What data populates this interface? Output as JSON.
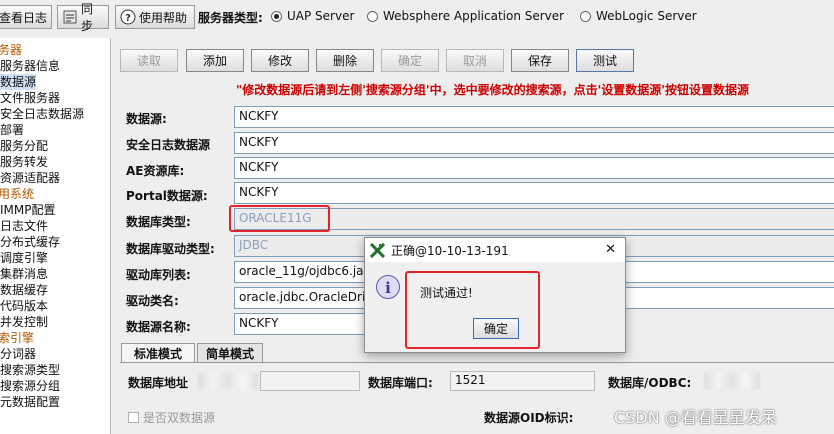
{
  "toolbar": {
    "view_log": "查看日志",
    "sync": "同步",
    "help": "使用帮助",
    "server_type_label": "服务器类型:",
    "server_options": [
      "UAP Server",
      "Websphere Application Server",
      "WebLogic Server"
    ],
    "selected_server": "UAP Server"
  },
  "tree": {
    "items": [
      "务器",
      "服务器信息",
      "数据源",
      "文件服务器",
      "安全日志数据源",
      "部署",
      "服务分配",
      "服务转发",
      "资源适配器",
      "用系统",
      "IMMP配置",
      "日志文件",
      "分布式缓存",
      "调度引擎",
      "集群消息",
      "数据缓存",
      "代码版本",
      "并发控制",
      "索引擎",
      "分词器",
      "搜索源类型",
      "搜索源分组",
      "元数据配置"
    ],
    "selected": "数据源"
  },
  "actions": {
    "read": "读取",
    "add": "添加",
    "modify": "修改",
    "delete": "删除",
    "confirm": "确定",
    "cancel": "取消",
    "save": "保存",
    "test": "测试"
  },
  "notice": "\"修改数据源后请到左侧'搜索源分组'中，选中要修改的搜索源，点击'设置数据源'按钮设置数据源",
  "form": {
    "datasource_label": "数据源:",
    "datasource_value": "NCKFY",
    "security_log_label": "安全日志数据源",
    "security_log_value": "NCKFY",
    "ae_label": "AE资源库:",
    "ae_value": "NCKFY",
    "portal_label": "Portal数据源:",
    "portal_value": "NCKFY",
    "dbtype_label": "数据库类型:",
    "dbtype_value": "ORACLE11G",
    "driver_type_label": "数据库驱动类型:",
    "driver_type_value": "JDBC",
    "driver_list_label": "驱动库列表:",
    "driver_list_value": "oracle_11g/ojdbc6.ja",
    "driver_class_label": "驱动类名:",
    "driver_class_value": "oracle.jdbc.OracleDriv",
    "ds_name_label": "数据源名称:",
    "ds_name_value": "NCKFY"
  },
  "tabs": {
    "standard": "标准模式",
    "simple": "简单模式"
  },
  "panel": {
    "db_address_label": "数据库地址",
    "db_port_label": "数据库端口:",
    "db_port_value": "1521",
    "odbc_label": "数据库/ODBC:",
    "dual_ds_label": "是否双数据源",
    "oid_label": "数据源OID标识:"
  },
  "dialog": {
    "title": "正确@10-10-13-191",
    "message": "测试通过!",
    "ok": "确定",
    "close": "✕"
  },
  "watermark": "CSDN @看看星星发呆",
  "colors": {
    "highlight": "#e3242b",
    "notice": "#cc0000"
  }
}
